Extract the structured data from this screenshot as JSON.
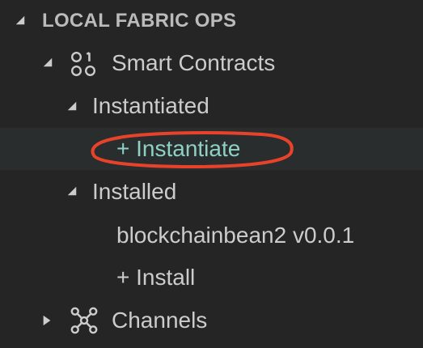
{
  "section": {
    "title": "LOCAL FABRIC OPS"
  },
  "tree": {
    "smart_contracts": "Smart Contracts",
    "instantiated": "Instantiated",
    "instantiate_action": "+ Instantiate",
    "installed": "Installed",
    "installed_item": "blockchainbean2 v0.0.1",
    "install_action": "+ Install",
    "channels": "Channels"
  },
  "icons": {
    "smart_contracts": "smart-contracts-icon",
    "channels": "channels-network-icon"
  },
  "colors": {
    "background": "#252526",
    "text": "#cccccc",
    "highlight_text": "#8ed1c4",
    "annotation": "#e8432a"
  }
}
